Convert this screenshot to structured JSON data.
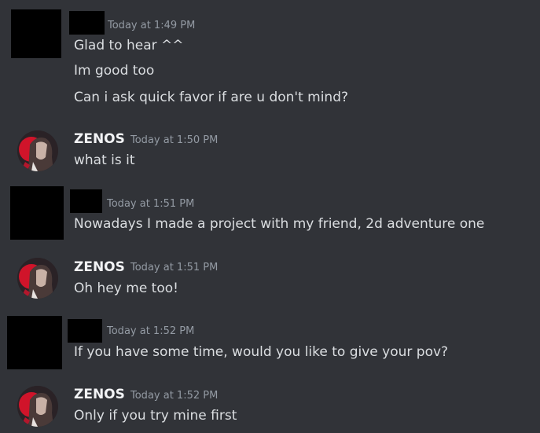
{
  "messages": [
    {
      "author": "",
      "timestamp": "Today at 1:49 PM",
      "lines": [
        "Glad to hear ^^",
        "Im good too",
        "Can i ask quick favor if are u don't mind?"
      ]
    },
    {
      "author": "ZENOS",
      "timestamp": "Today at 1:50 PM",
      "lines": [
        "what is it"
      ]
    },
    {
      "author": "",
      "timestamp": "Today at 1:51 PM",
      "lines": [
        "Nowadays I made a project with my friend, 2d adventure one"
      ]
    },
    {
      "author": "ZENOS",
      "timestamp": "Today at 1:51 PM",
      "lines": [
        "Oh hey me too!"
      ]
    },
    {
      "author": "",
      "timestamp": "Today at 1:52 PM",
      "lines": [
        "If you have some time, would you like to give your pov?"
      ]
    },
    {
      "author": "ZENOS",
      "timestamp": "Today at 1:52 PM",
      "lines": [
        "Only if you try mine first"
      ]
    }
  ],
  "colors": {
    "background": "#313338",
    "text": "#dbdee1",
    "username": "#f2f3f5",
    "timestamp": "#949ba4",
    "redaction": "#000000"
  }
}
